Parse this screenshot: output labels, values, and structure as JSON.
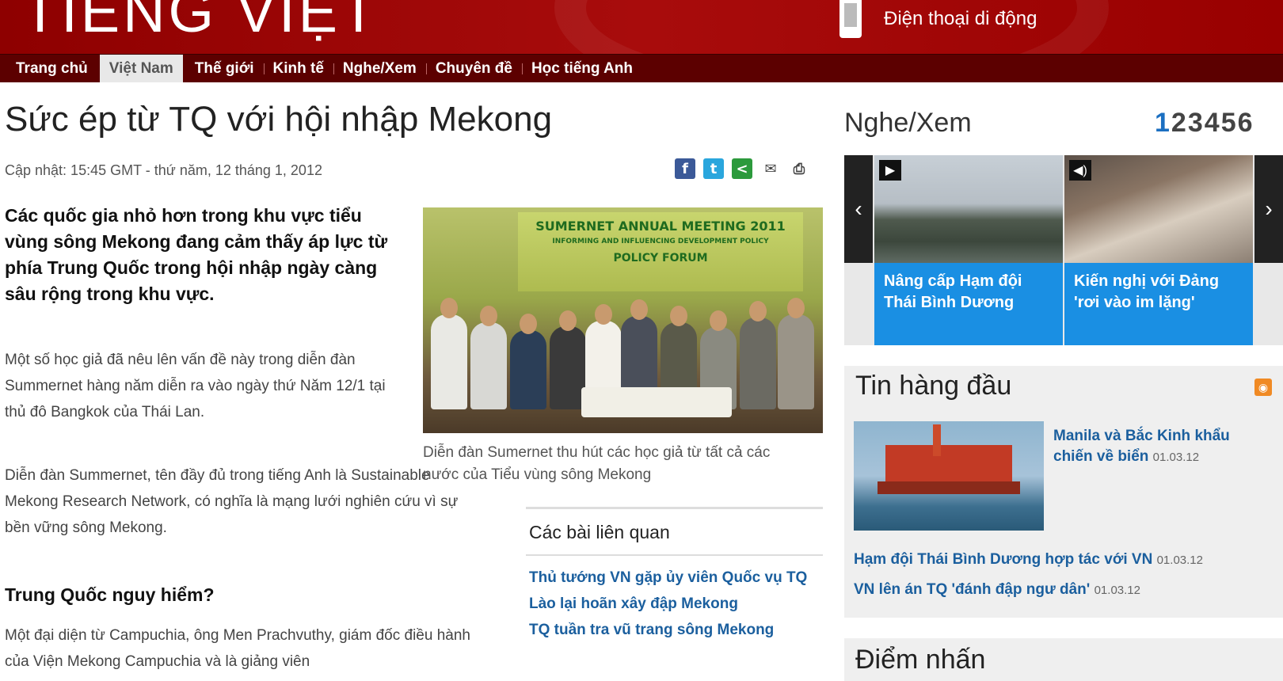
{
  "header": {
    "site_title": "TIẾNG VIỆT",
    "mobile_label": "Điện thoại di động"
  },
  "nav": {
    "items": [
      {
        "label": "Trang chủ",
        "active": false
      },
      {
        "label": "Việt Nam",
        "active": true
      },
      {
        "label": "Thế giới",
        "active": false
      },
      {
        "label": "Kinh tế",
        "active": false
      },
      {
        "label": "Nghe/Xem",
        "active": false
      },
      {
        "label": "Chuyên đề",
        "active": false
      },
      {
        "label": "Học tiếng Anh",
        "active": false
      }
    ]
  },
  "article": {
    "title": "Sức ép từ TQ với hội nhập Mekong",
    "updated": "Cập nhật: 15:45 GMT - thứ năm, 12 tháng 1, 2012",
    "lede": "Các quốc gia nhỏ hơn trong khu vực tiểu vùng sông Mekong đang cảm thấy áp lực từ phía Trung Quốc trong hội nhập ngày càng sâu rộng trong khu vực.",
    "paragraphs": [
      "Một số học giả đã nêu lên vấn đề này trong diễn đàn Summernet hàng năm diễn ra vào ngày thứ Năm 12/1 tại thủ đô Bangkok của Thái Lan.",
      "Diễn đàn Summernet, tên đầy đủ trong tiếng Anh là Sustainable Mekong Research Network, có nghĩa là mạng lưới nghiên cứu vì sự bền vững sông Mekong.",
      "Một đại diện từ Campuchia, ông Men Prachvuthy, giám đốc điều hành của Viện Mekong Campuchia và là giảng viên"
    ],
    "subheading": "Trung Quốc nguy hiểm?",
    "photo": {
      "banner_line1": "SUMERNET ANNUAL MEETING 2011",
      "banner_line2": "INFORMING AND INFLUENCING DEVELOPMENT POLICY",
      "banner_line3": "POLICY FORUM",
      "caption": "Diễn đàn Sumernet thu hút các học giả từ tất cả các nước của Tiểu vùng sông Mekong"
    },
    "share_icons": [
      "facebook-icon",
      "twitter-icon",
      "share-icon",
      "email-icon",
      "print-icon"
    ]
  },
  "related": {
    "heading": "Các bài liên quan",
    "links": [
      "Thủ tướng VN gặp ủy viên Quốc vụ TQ",
      "Lào lại hoãn xây đập Mekong",
      "TQ tuần tra vũ trang sông Mekong"
    ]
  },
  "media": {
    "heading": "Nghe/Xem",
    "pages": [
      "1",
      "2",
      "3",
      "4",
      "5",
      "6"
    ],
    "current_page": "1",
    "slides": [
      {
        "caption": "Nâng cấp Hạm đội Thái Bình Dương",
        "icon": "play-icon"
      },
      {
        "caption": "Kiến nghị với Đảng 'rơi vào im lặng'",
        "icon": "audio-icon"
      }
    ],
    "third_partial": "S"
  },
  "top_stories": {
    "heading": "Tin hàng đầu",
    "lead": {
      "title": "Manila và Bắc Kinh khẩu chiến về biển",
      "date": "01.03.12"
    },
    "items": [
      {
        "title": "Hạm đội Thái Bình Dương hợp tác với VN",
        "date": "01.03.12"
      },
      {
        "title": "VN lên án TQ 'đánh đập ngư dân'",
        "date": "01.03.12"
      }
    ]
  },
  "highlights": {
    "heading": "Điểm nhấn"
  },
  "colors": {
    "brand_red": "#990000",
    "nav_dark": "#5c0000",
    "link_blue": "#1b5f9e",
    "slide_blue": "#1a8fe3"
  }
}
